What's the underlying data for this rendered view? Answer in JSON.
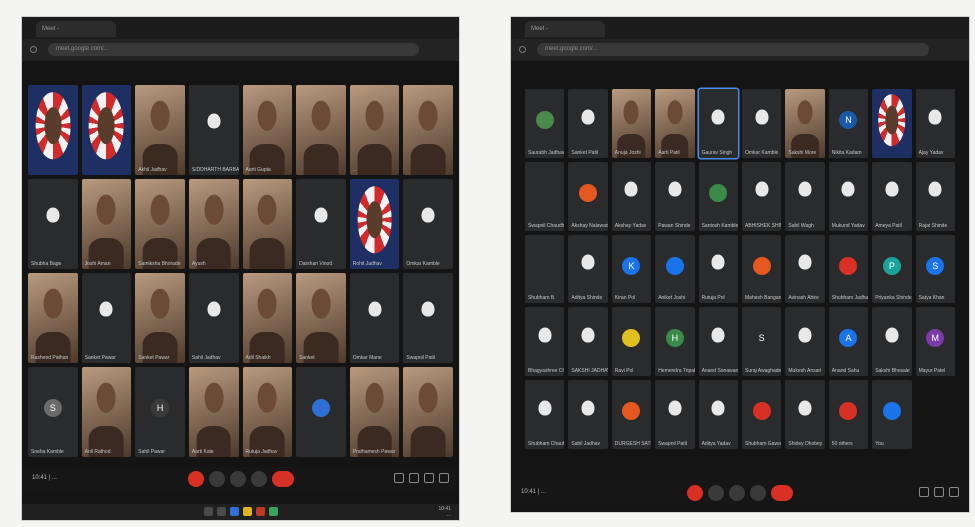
{
  "left": {
    "tab_label": "Meet - ",
    "url": "meet.google.com/...",
    "footer_text": "10:41 | ...",
    "taskbar_time": "10:41",
    "taskbar_date": "...",
    "tiles": [
      {
        "kind": "logo",
        "name": ""
      },
      {
        "kind": "logo",
        "name": ""
      },
      {
        "kind": "video",
        "name": "Akhil Jadhav"
      },
      {
        "kind": "face",
        "name": "SIDDHARTH BARBADE",
        "color": "#2a2b2d"
      },
      {
        "kind": "video",
        "name": "Aarti Gupta"
      },
      {
        "kind": "video",
        "name": ""
      },
      {
        "kind": "video",
        "name": "..."
      },
      {
        "kind": "video",
        "name": ""
      },
      {
        "kind": "face",
        "name": "Shubha Bage",
        "color": "#2a2b2d"
      },
      {
        "kind": "video",
        "name": "Joshi Aman"
      },
      {
        "kind": "video",
        "name": "Samiksha Bhorade"
      },
      {
        "kind": "video",
        "name": "Ayush"
      },
      {
        "kind": "video",
        "name": ""
      },
      {
        "kind": "face",
        "name": "Darshan Vinod",
        "color": "#2a2b2d"
      },
      {
        "kind": "logo",
        "name": "Rohit Jadhav"
      },
      {
        "kind": "face",
        "name": "Omkar Kamble",
        "color": "#2a2b2d"
      },
      {
        "kind": "video",
        "name": "Rasheed Pathan"
      },
      {
        "kind": "face",
        "name": "Sanket Pawar",
        "color": "#2a2b2d"
      },
      {
        "kind": "video",
        "name": "Sanket Pawar"
      },
      {
        "kind": "face",
        "name": "Sahil Jadhav",
        "color": "#2a2b2d"
      },
      {
        "kind": "video",
        "name": "Adil Shaikh"
      },
      {
        "kind": "video",
        "name": "Sanket"
      },
      {
        "kind": "face",
        "name": "Omkar Mane",
        "color": "#2a2b2d"
      },
      {
        "kind": "face",
        "name": "Swapnil Patil",
        "color": "#2a2b2d"
      },
      {
        "kind": "avatar",
        "letter": "S",
        "name": "Sneha Kamble",
        "color": "#6b6b6b"
      },
      {
        "kind": "video",
        "name": "Anil Rathod"
      },
      {
        "kind": "avatar",
        "letter": "H",
        "name": "Sahil Pawar",
        "color": "#3a3a3a"
      },
      {
        "kind": "video",
        "name": "Aarti Kale"
      },
      {
        "kind": "video",
        "name": "Rutuja Jadhav"
      },
      {
        "kind": "avatar",
        "letter": "",
        "name": "",
        "color": "#2f6fd6"
      },
      {
        "kind": "video",
        "name": "Prathamesh Pawar"
      },
      {
        "kind": "video",
        "name": ""
      }
    ]
  },
  "right": {
    "tab_label": "Meet - ",
    "url": "meet.google.com/...",
    "footer_text": "10:41 | ...",
    "tiles": [
      {
        "kind": "avatar",
        "letter": "",
        "name": "Saurabh Jadhav",
        "color": "#4a8a4a"
      },
      {
        "kind": "face",
        "name": "Sanket Patil",
        "color": "#2a2b2d"
      },
      {
        "kind": "video",
        "name": "Anuja Joshi"
      },
      {
        "kind": "video",
        "name": "Aarti Patil"
      },
      {
        "kind": "face",
        "name": "Gaurav Singh",
        "color": "#2a2b2d",
        "selected": true
      },
      {
        "kind": "face",
        "name": "Omkar Kamble",
        "color": "#2a2b2d"
      },
      {
        "kind": "video",
        "name": "Sakshi More"
      },
      {
        "kind": "avatar",
        "letter": "N",
        "name": "Nikita Kadam",
        "color": "#1a5aa8"
      },
      {
        "kind": "logo",
        "name": ""
      },
      {
        "kind": "face",
        "name": "Ajay Yadav",
        "color": "#2a2b2d"
      },
      {
        "kind": "avatar",
        "letter": "",
        "name": "Swapnil Chaudhari",
        "color": "#2a2b2d"
      },
      {
        "kind": "avatar",
        "letter": "",
        "name": "Akshay Nalawade",
        "color": "#e4571e"
      },
      {
        "kind": "face",
        "name": "Akshay Yadav",
        "color": "#2a2b2d"
      },
      {
        "kind": "face",
        "name": "Pawan Shinde",
        "color": "#2a2b2d"
      },
      {
        "kind": "avatar",
        "letter": "",
        "name": "Santosh Kamble",
        "color": "#3a8a4a"
      },
      {
        "kind": "face",
        "name": "ABHISHEK SHINDE",
        "color": "#2a2b2d"
      },
      {
        "kind": "face",
        "name": "Sahil Wagh",
        "color": "#2a2b2d"
      },
      {
        "kind": "face",
        "name": "Mukund Yadav",
        "color": "#8a6a3a"
      },
      {
        "kind": "face",
        "name": "Ameya Patil",
        "color": "#2a2b2d"
      },
      {
        "kind": "face",
        "name": "Rajat Shinde",
        "color": "#2a2b2d"
      },
      {
        "kind": "avatar",
        "letter": "",
        "name": "Shubham B.",
        "color": "#2a2b2d"
      },
      {
        "kind": "face",
        "name": "Aditya Shinde",
        "color": "#2a2b2d"
      },
      {
        "kind": "avatar",
        "letter": "K",
        "name": "Kiran Pol",
        "color": "#1a73e8"
      },
      {
        "kind": "avatar",
        "letter": "",
        "name": "Aniket Joshi",
        "color": "#1a73e8"
      },
      {
        "kind": "face",
        "name": "Rutuja Pol",
        "color": "#2a2b2d"
      },
      {
        "kind": "avatar",
        "letter": "",
        "name": "Mahesh Bangare",
        "color": "#e4571e"
      },
      {
        "kind": "face",
        "name": "Avinash Ahire",
        "color": "#2a2b2d"
      },
      {
        "kind": "avatar",
        "letter": "",
        "name": "Shubham Jadhav",
        "color": "#d93025"
      },
      {
        "kind": "avatar",
        "letter": "P",
        "name": "Priyanka Shinde",
        "color": "#1aa39a"
      },
      {
        "kind": "avatar",
        "letter": "S",
        "name": "Satya Khan",
        "color": "#1a73e8"
      },
      {
        "kind": "face",
        "name": "Bhagyashree Chavan",
        "color": "#2a2b2d"
      },
      {
        "kind": "face",
        "name": "SAKSHI JADHAV",
        "color": "#2a2b2d"
      },
      {
        "kind": "avatar",
        "letter": "",
        "name": "Ravi Pol",
        "color": "#e0c020"
      },
      {
        "kind": "avatar",
        "letter": "H",
        "name": "Hemendra Tripathi",
        "color": "#3a8a4a"
      },
      {
        "kind": "face",
        "name": "Anand Sonawane",
        "color": "#2a2b2d"
      },
      {
        "kind": "avatar",
        "letter": "S",
        "name": "Suraj Awaghade",
        "color": "#2a2b2d"
      },
      {
        "kind": "face",
        "name": "Mukesh Ansari",
        "color": "#2a2b2d"
      },
      {
        "kind": "avatar",
        "letter": "A",
        "name": "Anand Sahu",
        "color": "#1a73e8"
      },
      {
        "kind": "face",
        "name": "Sakshi Bhosale",
        "color": "#2a2b2d"
      },
      {
        "kind": "avatar",
        "letter": "M",
        "name": "Mayur Patel",
        "color": "#7a3aa8"
      },
      {
        "kind": "face",
        "name": "Shubham Chauhan",
        "color": "#2a2b2d"
      },
      {
        "kind": "face",
        "name": "Sahil Jadhav",
        "color": "#2a2b2d"
      },
      {
        "kind": "avatar",
        "letter": "",
        "name": "DURGESH SATHE",
        "color": "#e4571e"
      },
      {
        "kind": "face",
        "name": "Swapnil Patil",
        "color": "#2a2b2d"
      },
      {
        "kind": "face",
        "name": "Aditya Yadav",
        "color": "#2a2b2d"
      },
      {
        "kind": "avatar",
        "letter": "",
        "name": "Shubham Gawade",
        "color": "#d93025"
      },
      {
        "kind": "face",
        "name": "Shirley Dhobey",
        "color": "#2a2b2d"
      },
      {
        "kind": "avatar",
        "letter": "",
        "name": "50 others",
        "color": "#d93025"
      },
      {
        "kind": "avatar",
        "letter": "",
        "name": "You",
        "color": "#1a73e8"
      }
    ]
  }
}
